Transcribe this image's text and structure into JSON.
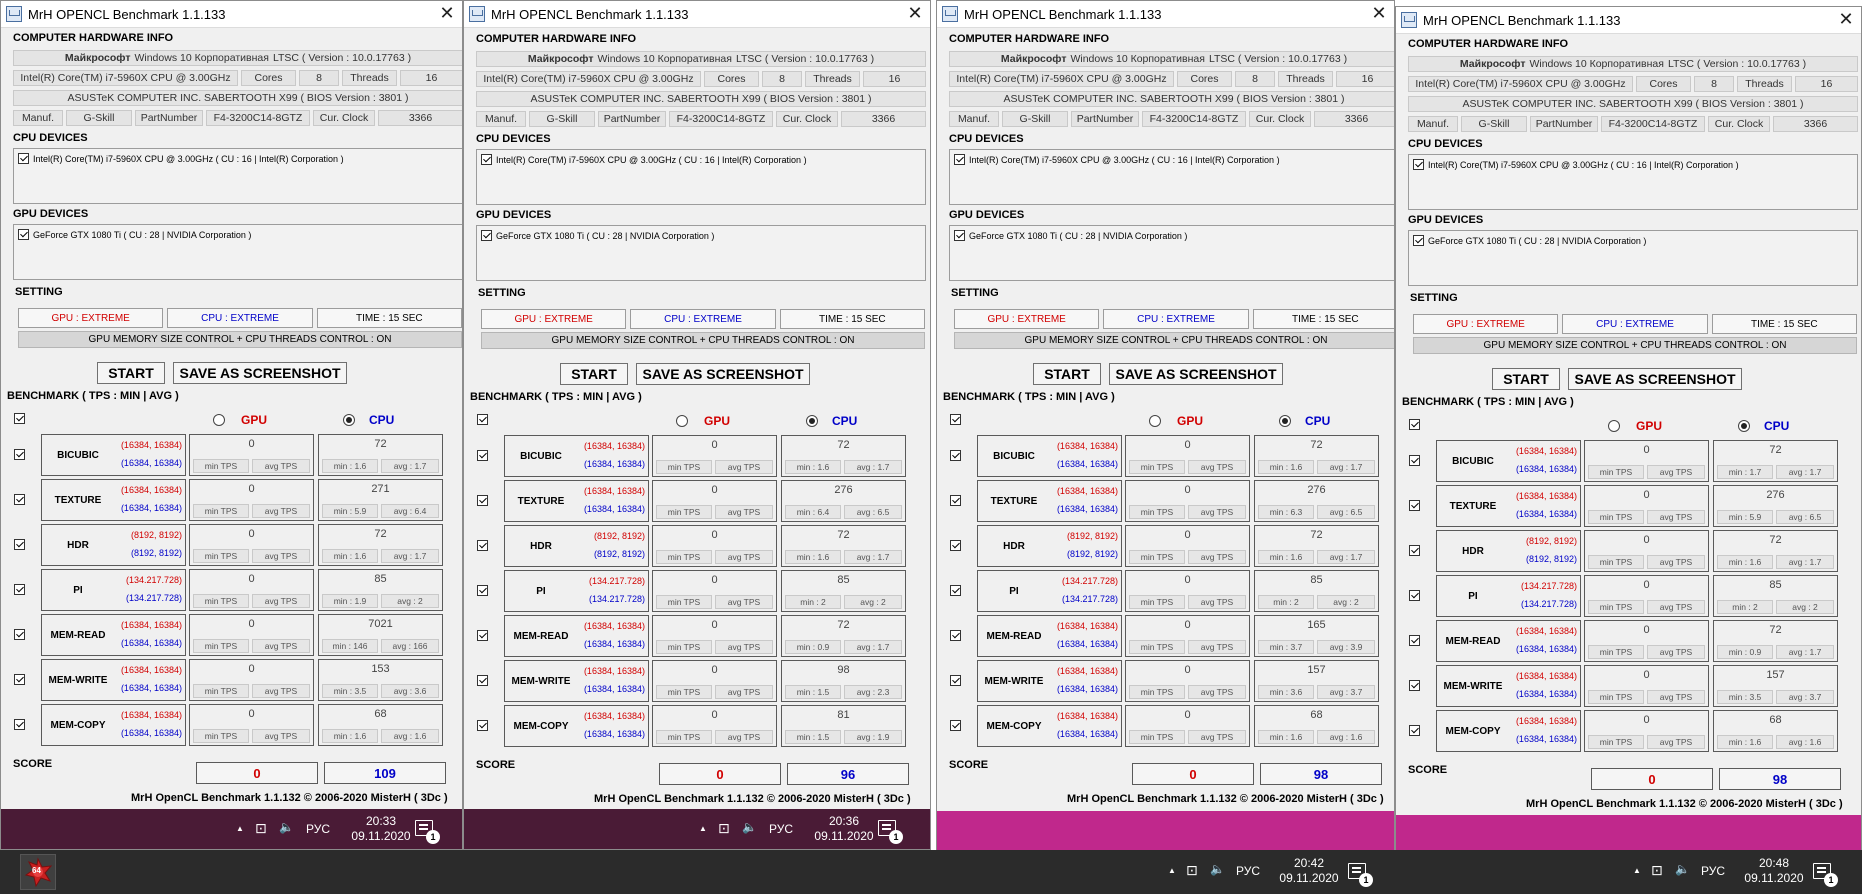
{
  "windows": [
    {
      "title": "MrH OPENCL Benchmark 1.1.133",
      "hardware_header": "COMPUTER HARDWARE INFO",
      "os": {
        "brand": "Майкрософт",
        "name": "Windows 10 Корпоративная",
        "suffix": "LTSC ( Version : 10.0.17763 )"
      },
      "cpu_name": "Intel(R) Core(TM) i7-5960X CPU @ 3.00GHz",
      "cores_label": "Cores",
      "cores": "8",
      "threads_label": "Threads",
      "threads": "16",
      "board": "ASUSTeK COMPUTER INC. SABERTOOTH X99 ( BIOS Version : 3801 )",
      "manuf_label": "Manuf.",
      "manuf": "G-Skill",
      "partnumber_label": "PartNumber",
      "partnumber": "F4-3200C14-8GTZ",
      "clock_label": "Cur. Clock",
      "clock": "3366",
      "cpu_devices_header": "CPU DEVICES",
      "cpu_device": "Intel(R) Core(TM) i7-5960X CPU @ 3.00GHz  ( CU : 16  |  Intel(R) Corporation )",
      "gpu_devices_header": "GPU DEVICES",
      "gpu_device": "GeForce GTX 1080 Ti  ( CU : 28  |  NVIDIA Corporation )",
      "setting_header": "SETTING",
      "gpu_setting": "GPU : EXTREME",
      "cpu_setting": "CPU : EXTREME",
      "time_setting": "TIME : 15 SEC",
      "control": "GPU MEMORY SIZE CONTROL + CPU THREADS CONTROL : ON",
      "start": "START",
      "save": "SAVE AS SCREENSHOT",
      "bench_header": "BENCHMARK ( TPS : MIN | AVG )",
      "gpu_label": "GPU",
      "cpu_label": "CPU",
      "tests": [
        {
          "name": "BICUBIC",
          "gsize": "(16384, 16384)",
          "csize": "(16384, 16384)",
          "gval": "0",
          "gmin": "min TPS",
          "gavg": "avg TPS",
          "cval": "72",
          "cmin": "min : 1.6",
          "cavg": "avg : 1.7"
        },
        {
          "name": "TEXTURE",
          "gsize": "(16384, 16384)",
          "csize": "(16384, 16384)",
          "gval": "0",
          "gmin": "min TPS",
          "gavg": "avg TPS",
          "cval": "271",
          "cmin": "min : 5.9",
          "cavg": "avg : 6.4"
        },
        {
          "name": "HDR",
          "gsize": "(8192, 8192)",
          "csize": "(8192, 8192)",
          "gval": "0",
          "gmin": "min TPS",
          "gavg": "avg TPS",
          "cval": "72",
          "cmin": "min : 1.6",
          "cavg": "avg : 1.7"
        },
        {
          "name": "PI",
          "gsize": "(134.217.728)",
          "csize": "(134.217.728)",
          "gval": "0",
          "gmin": "min TPS",
          "gavg": "avg TPS",
          "cval": "85",
          "cmin": "min : 1.9",
          "cavg": "avg : 2"
        },
        {
          "name": "MEM-READ",
          "gsize": "(16384, 16384)",
          "csize": "(16384, 16384)",
          "gval": "0",
          "gmin": "min TPS",
          "gavg": "avg TPS",
          "cval": "7021",
          "cmin": "min : 146",
          "cavg": "avg : 166"
        },
        {
          "name": "MEM-WRITE",
          "gsize": "(16384, 16384)",
          "csize": "(16384, 16384)",
          "gval": "0",
          "gmin": "min TPS",
          "gavg": "avg TPS",
          "cval": "153",
          "cmin": "min : 3.5",
          "cavg": "avg : 3.6"
        },
        {
          "name": "MEM-COPY",
          "gsize": "(16384, 16384)",
          "csize": "(16384, 16384)",
          "gval": "0",
          "gmin": "min TPS",
          "gavg": "avg TPS",
          "cval": "68",
          "cmin": "min : 1.6",
          "cavg": "avg : 1.6"
        }
      ],
      "score_label": "SCORE",
      "gpu_score": "0",
      "cpu_score": "109",
      "footer": "MrH OpenCL Benchmark 1.1.132  ©  2006-2020 MisterH  ( 3Dc )",
      "taskbar": {
        "lang": "РУС",
        "time": "20:33",
        "date": "09.11.2020",
        "badge": "1"
      }
    },
    {
      "title": "MrH OPENCL Benchmark 1.1.133",
      "hardware_header": "COMPUTER HARDWARE INFO",
      "os": {
        "brand": "Майкрософт",
        "name": "Windows 10 Корпоративная",
        "suffix": "LTSC ( Version : 10.0.17763 )"
      },
      "cpu_name": "Intel(R) Core(TM) i7-5960X CPU @ 3.00GHz",
      "cores_label": "Cores",
      "cores": "8",
      "threads_label": "Threads",
      "threads": "16",
      "board": "ASUSTeK COMPUTER INC. SABERTOOTH X99 ( BIOS Version : 3801 )",
      "manuf_label": "Manuf.",
      "manuf": "G-Skill",
      "partnumber_label": "PartNumber",
      "partnumber": "F4-3200C14-8GTZ",
      "clock_label": "Cur. Clock",
      "clock": "3366",
      "cpu_devices_header": "CPU DEVICES",
      "cpu_device": "Intel(R) Core(TM) i7-5960X CPU @ 3.00GHz  ( CU : 16  |  Intel(R) Corporation )",
      "gpu_devices_header": "GPU DEVICES",
      "gpu_device": "GeForce GTX 1080 Ti  ( CU : 28  |  NVIDIA Corporation )",
      "setting_header": "SETTING",
      "gpu_setting": "GPU : EXTREME",
      "cpu_setting": "CPU : EXTREME",
      "time_setting": "TIME : 15 SEC",
      "control": "GPU MEMORY SIZE CONTROL + CPU THREADS CONTROL : ON",
      "start": "START",
      "save": "SAVE AS SCREENSHOT",
      "bench_header": "BENCHMARK ( TPS : MIN | AVG )",
      "gpu_label": "GPU",
      "cpu_label": "CPU",
      "tests": [
        {
          "name": "BICUBIC",
          "gsize": "(16384, 16384)",
          "csize": "(16384, 16384)",
          "gval": "0",
          "gmin": "min TPS",
          "gavg": "avg TPS",
          "cval": "72",
          "cmin": "min : 1.6",
          "cavg": "avg : 1.7"
        },
        {
          "name": "TEXTURE",
          "gsize": "(16384, 16384)",
          "csize": "(16384, 16384)",
          "gval": "0",
          "gmin": "min TPS",
          "gavg": "avg TPS",
          "cval": "276",
          "cmin": "min : 6.4",
          "cavg": "avg : 6.5"
        },
        {
          "name": "HDR",
          "gsize": "(8192, 8192)",
          "csize": "(8192, 8192)",
          "gval": "0",
          "gmin": "min TPS",
          "gavg": "avg TPS",
          "cval": "72",
          "cmin": "min : 1.6",
          "cavg": "avg : 1.7"
        },
        {
          "name": "PI",
          "gsize": "(134.217.728)",
          "csize": "(134.217.728)",
          "gval": "0",
          "gmin": "min TPS",
          "gavg": "avg TPS",
          "cval": "85",
          "cmin": "min : 2",
          "cavg": "avg : 2"
        },
        {
          "name": "MEM-READ",
          "gsize": "(16384, 16384)",
          "csize": "(16384, 16384)",
          "gval": "0",
          "gmin": "min TPS",
          "gavg": "avg TPS",
          "cval": "72",
          "cmin": "min : 0.9",
          "cavg": "avg : 1.7"
        },
        {
          "name": "MEM-WRITE",
          "gsize": "(16384, 16384)",
          "csize": "(16384, 16384)",
          "gval": "0",
          "gmin": "min TPS",
          "gavg": "avg TPS",
          "cval": "98",
          "cmin": "min : 1.5",
          "cavg": "avg : 2.3"
        },
        {
          "name": "MEM-COPY",
          "gsize": "(16384, 16384)",
          "csize": "(16384, 16384)",
          "gval": "0",
          "gmin": "min TPS",
          "gavg": "avg TPS",
          "cval": "81",
          "cmin": "min : 1.5",
          "cavg": "avg : 1.9"
        }
      ],
      "score_label": "SCORE",
      "gpu_score": "0",
      "cpu_score": "96",
      "footer": "MrH OpenCL Benchmark 1.1.132  ©  2006-2020 MisterH  ( 3Dc )",
      "taskbar": {
        "lang": "РУС",
        "time": "20:36",
        "date": "09.11.2020",
        "badge": "1"
      }
    },
    {
      "title": "MrH OPENCL Benchmark 1.1.133",
      "hardware_header": "COMPUTER HARDWARE INFO",
      "os": {
        "brand": "Майкрософт",
        "name": "Windows 10 Корпоративная",
        "suffix": "LTSC ( Version : 10.0.17763 )"
      },
      "cpu_name": "Intel(R) Core(TM) i7-5960X CPU @ 3.00GHz",
      "cores_label": "Cores",
      "cores": "8",
      "threads_label": "Threads",
      "threads": "16",
      "board": "ASUSTeK COMPUTER INC. SABERTOOTH X99 ( BIOS Version : 3801 )",
      "manuf_label": "Manuf.",
      "manuf": "G-Skill",
      "partnumber_label": "PartNumber",
      "partnumber": "F4-3200C14-8GTZ",
      "clock_label": "Cur. Clock",
      "clock": "3366",
      "cpu_devices_header": "CPU DEVICES",
      "cpu_device": "Intel(R) Core(TM) i7-5960X CPU @ 3.00GHz  ( CU : 16  |  Intel(R) Corporation )",
      "gpu_devices_header": "GPU DEVICES",
      "gpu_device": "GeForce GTX 1080 Ti  ( CU : 28  |  NVIDIA Corporation )",
      "setting_header": "SETTING",
      "gpu_setting": "GPU : EXTREME",
      "cpu_setting": "CPU : EXTREME",
      "time_setting": "TIME : 15 SEC",
      "control": "GPU MEMORY SIZE CONTROL + CPU THREADS CONTROL : ON",
      "start": "START",
      "save": "SAVE AS SCREENSHOT",
      "bench_header": "BENCHMARK ( TPS : MIN | AVG )",
      "gpu_label": "GPU",
      "cpu_label": "CPU",
      "tests": [
        {
          "name": "BICUBIC",
          "gsize": "(16384, 16384)",
          "csize": "(16384, 16384)",
          "gval": "0",
          "gmin": "min TPS",
          "gavg": "avg TPS",
          "cval": "72",
          "cmin": "min : 1.6",
          "cavg": "avg : 1.7"
        },
        {
          "name": "TEXTURE",
          "gsize": "(16384, 16384)",
          "csize": "(16384, 16384)",
          "gval": "0",
          "gmin": "min TPS",
          "gavg": "avg TPS",
          "cval": "276",
          "cmin": "min : 6.3",
          "cavg": "avg : 6.5"
        },
        {
          "name": "HDR",
          "gsize": "(8192, 8192)",
          "csize": "(8192, 8192)",
          "gval": "0",
          "gmin": "min TPS",
          "gavg": "avg TPS",
          "cval": "72",
          "cmin": "min : 1.6",
          "cavg": "avg : 1.7"
        },
        {
          "name": "PI",
          "gsize": "(134.217.728)",
          "csize": "(134.217.728)",
          "gval": "0",
          "gmin": "min TPS",
          "gavg": "avg TPS",
          "cval": "85",
          "cmin": "min : 2",
          "cavg": "avg : 2"
        },
        {
          "name": "MEM-READ",
          "gsize": "(16384, 16384)",
          "csize": "(16384, 16384)",
          "gval": "0",
          "gmin": "min TPS",
          "gavg": "avg TPS",
          "cval": "165",
          "cmin": "min : 3.7",
          "cavg": "avg : 3.9"
        },
        {
          "name": "MEM-WRITE",
          "gsize": "(16384, 16384)",
          "csize": "(16384, 16384)",
          "gval": "0",
          "gmin": "min TPS",
          "gavg": "avg TPS",
          "cval": "157",
          "cmin": "min : 3.6",
          "cavg": "avg : 3.7"
        },
        {
          "name": "MEM-COPY",
          "gsize": "(16384, 16384)",
          "csize": "(16384, 16384)",
          "gval": "0",
          "gmin": "min TPS",
          "gavg": "avg TPS",
          "cval": "68",
          "cmin": "min : 1.6",
          "cavg": "avg : 1.6"
        }
      ],
      "score_label": "SCORE",
      "gpu_score": "0",
      "cpu_score": "98",
      "footer": "MrH OpenCL Benchmark 1.1.132  ©  2006-2020 MisterH  ( 3Dc )",
      "taskbar": {
        "lang": "РУС",
        "time": "20:42",
        "date": "09.11.2020",
        "badge": "1"
      }
    },
    {
      "title": "MrH OPENCL Benchmark 1.1.133",
      "hardware_header": "COMPUTER HARDWARE INFO",
      "os": {
        "brand": "Майкрософт",
        "name": "Windows 10 Корпоративная",
        "suffix": "LTSC ( Version : 10.0.17763 )"
      },
      "cpu_name": "Intel(R) Core(TM) i7-5960X CPU @ 3.00GHz",
      "cores_label": "Cores",
      "cores": "8",
      "threads_label": "Threads",
      "threads": "16",
      "board": "ASUSTeK COMPUTER INC. SABERTOOTH X99 ( BIOS Version : 3801 )",
      "manuf_label": "Manuf.",
      "manuf": "G-Skill",
      "partnumber_label": "PartNumber",
      "partnumber": "F4-3200C14-8GTZ",
      "clock_label": "Cur. Clock",
      "clock": "3366",
      "cpu_devices_header": "CPU DEVICES",
      "cpu_device": "Intel(R) Core(TM) i7-5960X CPU @ 3.00GHz  ( CU : 16  |  Intel(R) Corporation )",
      "gpu_devices_header": "GPU DEVICES",
      "gpu_device": "GeForce GTX 1080 Ti  ( CU : 28  |  NVIDIA Corporation )",
      "setting_header": "SETTING",
      "gpu_setting": "GPU : EXTREME",
      "cpu_setting": "CPU : EXTREME",
      "time_setting": "TIME : 15 SEC",
      "control": "GPU MEMORY SIZE CONTROL + CPU THREADS CONTROL : ON",
      "start": "START",
      "save": "SAVE AS SCREENSHOT",
      "bench_header": "BENCHMARK ( TPS : MIN | AVG )",
      "gpu_label": "GPU",
      "cpu_label": "CPU",
      "tests": [
        {
          "name": "BICUBIC",
          "gsize": "(16384, 16384)",
          "csize": "(16384, 16384)",
          "gval": "0",
          "gmin": "min TPS",
          "gavg": "avg TPS",
          "cval": "72",
          "cmin": "min : 1.7",
          "cavg": "avg : 1.7"
        },
        {
          "name": "TEXTURE",
          "gsize": "(16384, 16384)",
          "csize": "(16384, 16384)",
          "gval": "0",
          "gmin": "min TPS",
          "gavg": "avg TPS",
          "cval": "276",
          "cmin": "min : 5.9",
          "cavg": "avg : 6.5"
        },
        {
          "name": "HDR",
          "gsize": "(8192, 8192)",
          "csize": "(8192, 8192)",
          "gval": "0",
          "gmin": "min TPS",
          "gavg": "avg TPS",
          "cval": "72",
          "cmin": "min : 1.6",
          "cavg": "avg : 1.7"
        },
        {
          "name": "PI",
          "gsize": "(134.217.728)",
          "csize": "(134.217.728)",
          "gval": "0",
          "gmin": "min TPS",
          "gavg": "avg TPS",
          "cval": "85",
          "cmin": "min : 2",
          "cavg": "avg : 2"
        },
        {
          "name": "MEM-READ",
          "gsize": "(16384, 16384)",
          "csize": "(16384, 16384)",
          "gval": "0",
          "gmin": "min TPS",
          "gavg": "avg TPS",
          "cval": "72",
          "cmin": "min : 0.9",
          "cavg": "avg : 1.7"
        },
        {
          "name": "MEM-WRITE",
          "gsize": "(16384, 16384)",
          "csize": "(16384, 16384)",
          "gval": "0",
          "gmin": "min TPS",
          "gavg": "avg TPS",
          "cval": "157",
          "cmin": "min : 3.5",
          "cavg": "avg : 3.7"
        },
        {
          "name": "MEM-COPY",
          "gsize": "(16384, 16384)",
          "csize": "(16384, 16384)",
          "gval": "0",
          "gmin": "min TPS",
          "gavg": "avg TPS",
          "cval": "68",
          "cmin": "min : 1.6",
          "cavg": "avg : 1.6"
        }
      ],
      "score_label": "SCORE",
      "gpu_score": "0",
      "cpu_score": "98",
      "footer": "MrH OpenCL Benchmark 1.1.132  ©  2006-2020 MisterH  ( 3Dc )",
      "taskbar": {
        "lang": "РУС",
        "time": "20:48",
        "date": "09.11.2020",
        "badge": "1"
      }
    }
  ],
  "start_badge": "64",
  "colors": {
    "gpu": "#d10000",
    "cpu": "#0000c8",
    "taskbar_dark": "#4a1b36",
    "taskbar_magenta": "#c0288c",
    "main_taskbar": "#2b2b2b"
  },
  "icons": [
    "app-window-icon",
    "close-icon",
    "checkbox-icon",
    "radio-icon",
    "tray-up-arrow-icon",
    "network-icon",
    "volume-icon",
    "notification-icon",
    "start-logo-icon"
  ]
}
